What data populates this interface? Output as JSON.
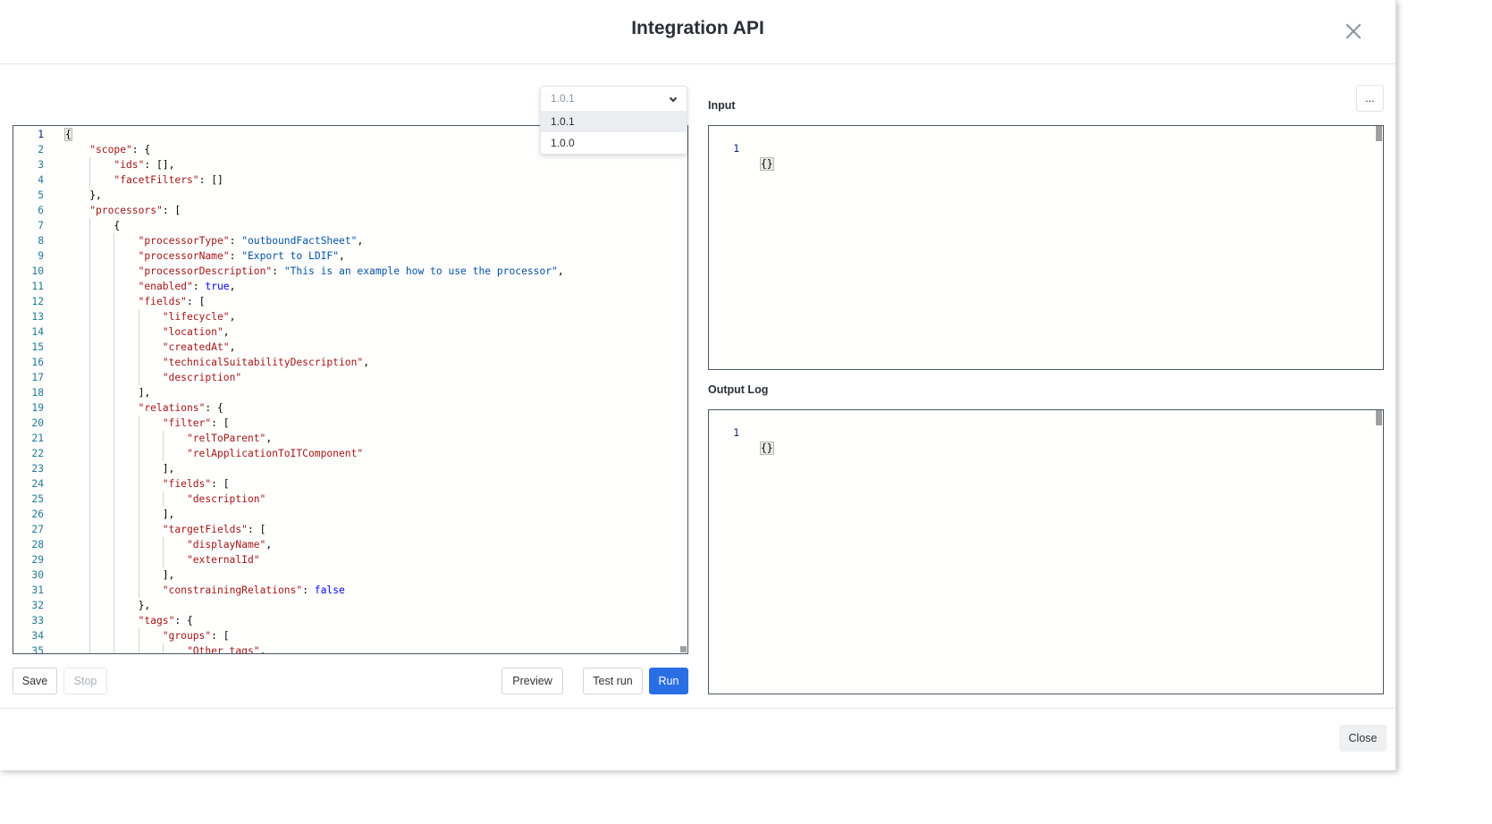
{
  "header": {
    "title": "Integration API"
  },
  "version_dropdown": {
    "selected": "1.0.1",
    "options": [
      "1.0.1",
      "1.0.0"
    ]
  },
  "input_panel": {
    "label": "Input",
    "lines": [
      [
        "1",
        "{}"
      ]
    ]
  },
  "output_panel": {
    "label": "Output Log",
    "lines": [
      [
        "1",
        "{}"
      ]
    ]
  },
  "more_button": "...",
  "buttons": {
    "save": "Save",
    "stop": "Stop",
    "preview": "Preview",
    "test_run": "Test run",
    "run": "Run",
    "close": "Close"
  },
  "colors": {
    "primary": "#2a6ee5",
    "json_key": "#a31515",
    "json_string": "#0451a5",
    "json_literal": "#0000ff"
  },
  "editor": {
    "lines": [
      {
        "n": "1",
        "i": 0,
        "seg": [
          [
            "p",
            "{"
          ]
        ]
      },
      {
        "n": "2",
        "i": 1,
        "seg": [
          [
            "k",
            "\"scope\""
          ],
          [
            "p",
            ": {"
          ]
        ]
      },
      {
        "n": "3",
        "i": 2,
        "seg": [
          [
            "k",
            "\"ids\""
          ],
          [
            "p",
            ": [],"
          ]
        ]
      },
      {
        "n": "4",
        "i": 2,
        "seg": [
          [
            "k",
            "\"facetFilters\""
          ],
          [
            "p",
            ": []"
          ]
        ]
      },
      {
        "n": "5",
        "i": 1,
        "seg": [
          [
            "p",
            "},"
          ]
        ]
      },
      {
        "n": "6",
        "i": 1,
        "seg": [
          [
            "k",
            "\"processors\""
          ],
          [
            "p",
            ": ["
          ]
        ]
      },
      {
        "n": "7",
        "i": 2,
        "seg": [
          [
            "p",
            "{"
          ]
        ]
      },
      {
        "n": "8",
        "i": 3,
        "seg": [
          [
            "k",
            "\"processorType\""
          ],
          [
            "p",
            ": "
          ],
          [
            "s",
            "\"outboundFactSheet\""
          ],
          [
            "p",
            ","
          ]
        ]
      },
      {
        "n": "9",
        "i": 3,
        "seg": [
          [
            "k",
            "\"processorName\""
          ],
          [
            "p",
            ": "
          ],
          [
            "s",
            "\"Export to LDIF\""
          ],
          [
            "p",
            ","
          ]
        ]
      },
      {
        "n": "10",
        "i": 3,
        "seg": [
          [
            "k",
            "\"processorDescription\""
          ],
          [
            "p",
            ": "
          ],
          [
            "s",
            "\"This is an example how to use the processor\""
          ],
          [
            "p",
            ","
          ]
        ]
      },
      {
        "n": "11",
        "i": 3,
        "seg": [
          [
            "k",
            "\"enabled\""
          ],
          [
            "p",
            ": "
          ],
          [
            "b",
            "true"
          ],
          [
            "p",
            ","
          ]
        ]
      },
      {
        "n": "12",
        "i": 3,
        "seg": [
          [
            "k",
            "\"fields\""
          ],
          [
            "p",
            ": ["
          ]
        ]
      },
      {
        "n": "13",
        "i": 4,
        "seg": [
          [
            "k",
            "\"lifecycle\""
          ],
          [
            "p",
            ","
          ]
        ]
      },
      {
        "n": "14",
        "i": 4,
        "seg": [
          [
            "k",
            "\"location\""
          ],
          [
            "p",
            ","
          ]
        ]
      },
      {
        "n": "15",
        "i": 4,
        "seg": [
          [
            "k",
            "\"createdAt\""
          ],
          [
            "p",
            ","
          ]
        ]
      },
      {
        "n": "16",
        "i": 4,
        "seg": [
          [
            "k",
            "\"technicalSuitabilityDescription\""
          ],
          [
            "p",
            ","
          ]
        ]
      },
      {
        "n": "17",
        "i": 4,
        "seg": [
          [
            "k",
            "\"description\""
          ]
        ]
      },
      {
        "n": "18",
        "i": 3,
        "seg": [
          [
            "p",
            "],"
          ]
        ]
      },
      {
        "n": "19",
        "i": 3,
        "seg": [
          [
            "k",
            "\"relations\""
          ],
          [
            "p",
            ": {"
          ]
        ]
      },
      {
        "n": "20",
        "i": 4,
        "seg": [
          [
            "k",
            "\"filter\""
          ],
          [
            "p",
            ": ["
          ]
        ]
      },
      {
        "n": "21",
        "i": 5,
        "seg": [
          [
            "k",
            "\"relToParent\""
          ],
          [
            "p",
            ","
          ]
        ]
      },
      {
        "n": "22",
        "i": 5,
        "seg": [
          [
            "k",
            "\"relApplicationToITComponent\""
          ]
        ]
      },
      {
        "n": "23",
        "i": 4,
        "seg": [
          [
            "p",
            "],"
          ]
        ]
      },
      {
        "n": "24",
        "i": 4,
        "seg": [
          [
            "k",
            "\"fields\""
          ],
          [
            "p",
            ": ["
          ]
        ]
      },
      {
        "n": "25",
        "i": 5,
        "seg": [
          [
            "k",
            "\"description\""
          ]
        ]
      },
      {
        "n": "26",
        "i": 4,
        "seg": [
          [
            "p",
            "],"
          ]
        ]
      },
      {
        "n": "27",
        "i": 4,
        "seg": [
          [
            "k",
            "\"targetFields\""
          ],
          [
            "p",
            ": ["
          ]
        ]
      },
      {
        "n": "28",
        "i": 5,
        "seg": [
          [
            "k",
            "\"displayName\""
          ],
          [
            "p",
            ","
          ]
        ]
      },
      {
        "n": "29",
        "i": 5,
        "seg": [
          [
            "k",
            "\"externalId\""
          ]
        ]
      },
      {
        "n": "30",
        "i": 4,
        "seg": [
          [
            "p",
            "],"
          ]
        ]
      },
      {
        "n": "31",
        "i": 4,
        "seg": [
          [
            "k",
            "\"constrainingRelations\""
          ],
          [
            "p",
            ": "
          ],
          [
            "b",
            "false"
          ]
        ]
      },
      {
        "n": "32",
        "i": 3,
        "seg": [
          [
            "p",
            "},"
          ]
        ]
      },
      {
        "n": "33",
        "i": 3,
        "seg": [
          [
            "k",
            "\"tags\""
          ],
          [
            "p",
            ": {"
          ]
        ]
      },
      {
        "n": "34",
        "i": 4,
        "seg": [
          [
            "k",
            "\"groups\""
          ],
          [
            "p",
            ": ["
          ]
        ]
      },
      {
        "n": "35",
        "i": 5,
        "seg": [
          [
            "k",
            "\"Other tags\""
          ],
          [
            "p",
            ","
          ]
        ]
      }
    ]
  }
}
